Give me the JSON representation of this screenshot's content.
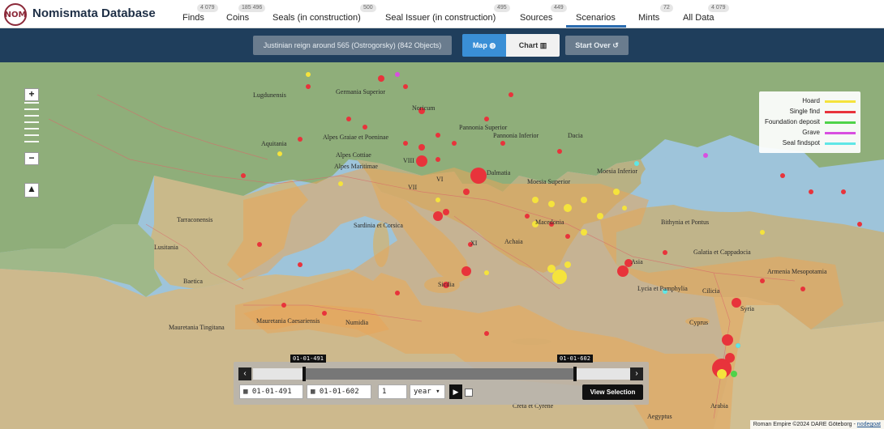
{
  "app": {
    "brand": "Nomismata Database",
    "logo_text": "NOM"
  },
  "nav": {
    "items": [
      {
        "label": "Finds",
        "badge": "4 079"
      },
      {
        "label": "Coins",
        "badge": "185 496"
      },
      {
        "label": "Seals (in construction)",
        "badge": "500"
      },
      {
        "label": "Seal Issuer (in construction)",
        "badge": "495"
      },
      {
        "label": "Sources",
        "badge": "449"
      },
      {
        "label": "Scenarios",
        "badge": ""
      },
      {
        "label": "Mints",
        "badge": "72"
      },
      {
        "label": "All Data",
        "badge": "4 079"
      }
    ],
    "active": "Scenarios"
  },
  "toolbar": {
    "scenario_label": "Justinian reign around 565 (Ostrogorsky)   (842 Objects)",
    "map_label": "Map",
    "chart_label": "Chart",
    "start_over_label": "Start Over"
  },
  "map": {
    "zoom_in": "+",
    "zoom_out": "−",
    "regions": [
      "Lugdunensis",
      "Germania Superior",
      "Noricum",
      "Pannonia Superior",
      "Pannonia Inferior",
      "Dacia",
      "Aquitania",
      "Alpes Graiae et Poeninae",
      "Alpes Cottiae",
      "Alpes Maritimae",
      "Dalmatia",
      "Moesia Superior",
      "Moesia Inferior",
      "Tarraconensis",
      "Lusitania",
      "Baetica",
      "Sardinia et Corsica",
      "Macedonia",
      "Achaia",
      "Bithynia et Pontus",
      "Galatia et Cappadocia",
      "Asia",
      "Lycia et Pamphylia",
      "Cilicia",
      "Armenia Mesopotamia",
      "Cyprus",
      "Syria",
      "Sicilia",
      "Mauretania Caesariensis",
      "Numidia",
      "Mauretania Tingitana",
      "Creta et Cyrene",
      "Aegyptus",
      "Arabia",
      "VIII",
      "VII",
      "VI",
      "XI"
    ],
    "legend": [
      {
        "label": "Hoard",
        "color": "#f5e33c"
      },
      {
        "label": "Single find",
        "color": "#e8333b"
      },
      {
        "label": "Foundation deposit",
        "color": "#4fd34a"
      },
      {
        "label": "Grave",
        "color": "#d84fe0"
      },
      {
        "label": "Seal findspot",
        "color": "#5fe6e6"
      }
    ],
    "attribution_text": "Roman Empire ©2024 DARE Göteborg - ",
    "attribution_link": "nodegoat"
  },
  "timeline": {
    "start_tip": "01-01-491",
    "end_tip": "01-01-602",
    "start_date": "01-01-491",
    "end_date": "01-01-602",
    "step_value": "1",
    "step_unit": "year",
    "view_selection_label": "View Selection",
    "prev_icon": "‹",
    "next_icon": "›",
    "play_icon": "▶",
    "calendar_icon": "▦"
  },
  "colors": {
    "hoard": "#f5e33c",
    "single_find": "#e8333b",
    "seal_findspot": "#5fe6e6",
    "empire_overlay": "#e7a55a"
  }
}
